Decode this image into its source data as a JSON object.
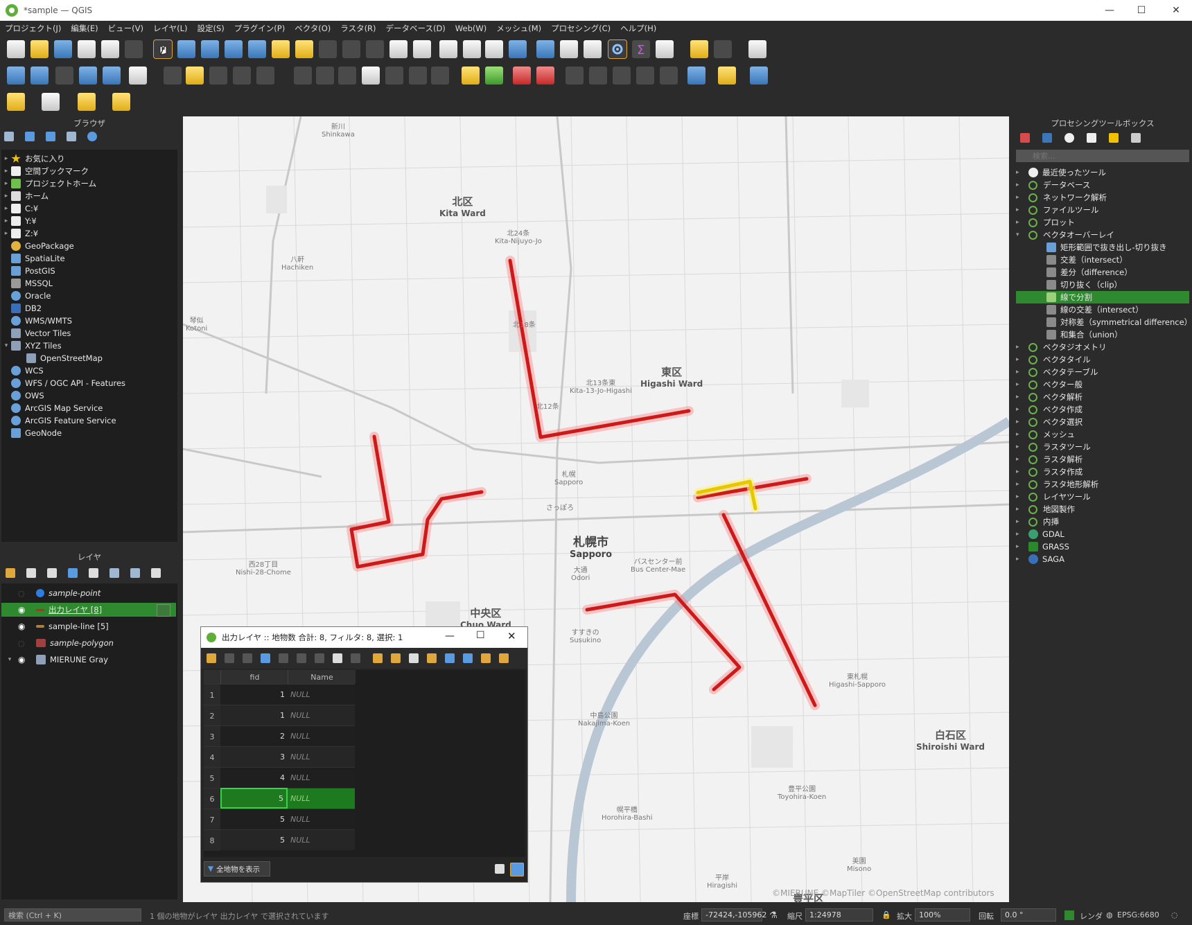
{
  "window": {
    "title": "*sample — QGIS"
  },
  "menu": [
    "プロジェクト(J)",
    "編集(E)",
    "ビュー(V)",
    "レイヤ(L)",
    "設定(S)",
    "プラグイン(P)",
    "ベクタ(O)",
    "ラスタ(R)",
    "データベース(D)",
    "Web(W)",
    "メッシュ(M)",
    "プロセシング(C)",
    "ヘルプ(H)"
  ],
  "browser": {
    "title": "ブラウザ",
    "items": [
      "お気に入り",
      "空間ブックマーク",
      "プロジェクトホーム",
      "ホーム",
      "C:¥",
      "Y:¥",
      "Z:¥",
      "GeoPackage",
      "SpatiaLite",
      "PostGIS",
      "MSSQL",
      "Oracle",
      "DB2",
      "WMS/WMTS",
      "Vector Tiles",
      "XYZ Tiles",
      "OpenStreetMap",
      "WCS",
      "WFS / OGC API - Features",
      "OWS",
      "ArcGIS Map Service",
      "ArcGIS Feature Service",
      "GeoNode"
    ]
  },
  "layers": {
    "title": "レイヤ",
    "items": [
      {
        "name": "sample-point",
        "visible": false,
        "italic": true
      },
      {
        "name": "出力レイヤ [8]",
        "visible": true,
        "selected": true
      },
      {
        "name": "sample-line [5]",
        "visible": true
      },
      {
        "name": "sample-polygon",
        "visible": false,
        "italic": true
      },
      {
        "name": "MIERUNE Gray",
        "visible": true
      }
    ]
  },
  "processing": {
    "title": "プロセシングツールボックス",
    "search_placeholder": "検索...",
    "groups_top": [
      "最近使ったツール",
      "データベース",
      "ネットワーク解析",
      "ファイルツール",
      "プロット",
      "ベクタオーバーレイ"
    ],
    "overlay_tools": [
      "矩形範囲で抜き出し-切り抜き",
      "交差（intersect）",
      "差分（difference）",
      "切り抜く（clip）",
      "線で分割",
      "線の交差（intersect）",
      "対称差（symmetrical difference）",
      "和集合（union）"
    ],
    "groups_bottom": [
      "ベクタジオメトリ",
      "ベクタタイル",
      "ベクタテーブル",
      "ベクター般",
      "ベクタ解析",
      "ベクタ作成",
      "ベクタ選択",
      "メッシュ",
      "ラスタツール",
      "ラスタ解析",
      "ラスタ作成",
      "ラスタ地形解析",
      "レイヤツール",
      "地図製作",
      "内挿",
      "GDAL",
      "GRASS",
      "SAGA"
    ]
  },
  "attribute_table": {
    "title": "出力レイヤ :: 地物数 合計: 8, フィルタ: 8, 選択: 1",
    "columns": [
      "fid",
      "Name"
    ],
    "rows": [
      {
        "n": "1",
        "fid": "1",
        "name": "NULL"
      },
      {
        "n": "2",
        "fid": "1",
        "name": "NULL"
      },
      {
        "n": "3",
        "fid": "2",
        "name": "NULL"
      },
      {
        "n": "4",
        "fid": "3",
        "name": "NULL"
      },
      {
        "n": "5",
        "fid": "4",
        "name": "NULL"
      },
      {
        "n": "6",
        "fid": "5",
        "name": "NULL",
        "selected": true
      },
      {
        "n": "7",
        "fid": "5",
        "name": "NULL"
      },
      {
        "n": "8",
        "fid": "5",
        "name": "NULL"
      }
    ],
    "show_all": "全地物を表示"
  },
  "map": {
    "labels": [
      {
        "t": "北区",
        "s": "Kita Ward"
      },
      {
        "t": "東区",
        "s": "Higashi Ward"
      },
      {
        "t": "札幌市",
        "s": "Sapporo"
      },
      {
        "t": "中央区",
        "s": "Chuo Ward"
      },
      {
        "t": "白石区",
        "s": "Shiroishi Ward"
      },
      {
        "t": "豊平区",
        "s": ""
      }
    ],
    "stations": [
      "北24条",
      "Kita-Nijuyo-Jo",
      "北18条",
      "北12条",
      "北13条東",
      "Kita-13-Jo-Higashi",
      "八軒",
      "Hachiken",
      "琴似",
      "Kotoni",
      "西28丁目",
      "Nishi-28-Chome",
      "札幌",
      "Sapporo",
      "さっぽろ",
      "大通",
      "Odori",
      "バスセンター前",
      "Bus Center-Mae",
      "すすきの",
      "Susukino",
      "中島公園",
      "Nakajima-Koen",
      "幌平橋",
      "Horohira-Bashi",
      "豊平公園",
      "Toyohira-Koen",
      "東札幌",
      "Higashi-Sapporo",
      "平岸",
      "Hiragishi",
      "美園",
      "Misono",
      "新川",
      "Shinkawa"
    ],
    "attribution": "©MIERUNE ©MapTiler ©OpenStreetMap contributors"
  },
  "status": {
    "search_placeholder": "検索 (Ctrl + K)",
    "message": "1 個の地物がレイヤ 出力レイヤ で選択されています",
    "coord_label": "座標",
    "coord": "-72424,-105962",
    "scale_label": "縮尺",
    "scale": "1:24978",
    "magnify_label": "拡大",
    "magnify": "100%",
    "rotation_label": "回転",
    "rotation": "0.0 °",
    "render_label": "レンダ",
    "crs": "EPSG:6680"
  }
}
